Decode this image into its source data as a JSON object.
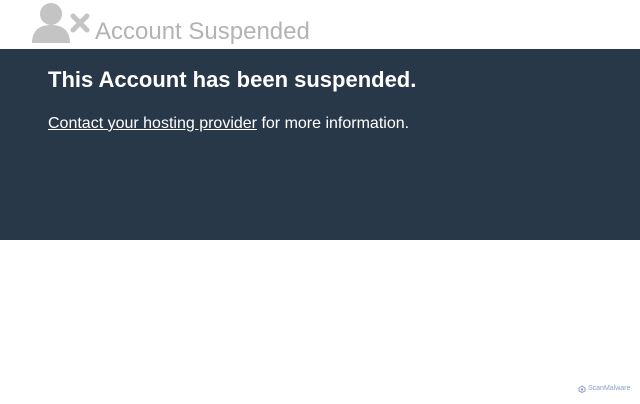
{
  "header": {
    "icon": "user-remove-icon",
    "title": "Account Suspended"
  },
  "banner": {
    "heading": "This Account has been suspended.",
    "link_text": "Contact your hosting provider",
    "suffix_text": " for more information."
  },
  "footer": {
    "logo_icon": "scanmalware-logo-icon",
    "brand": "ScanMalware"
  },
  "colors": {
    "banner_background": "#293849",
    "header_text": "#b3b3b3",
    "icon": "#c4c4c4",
    "brand_mark": "#8aa2c6"
  }
}
